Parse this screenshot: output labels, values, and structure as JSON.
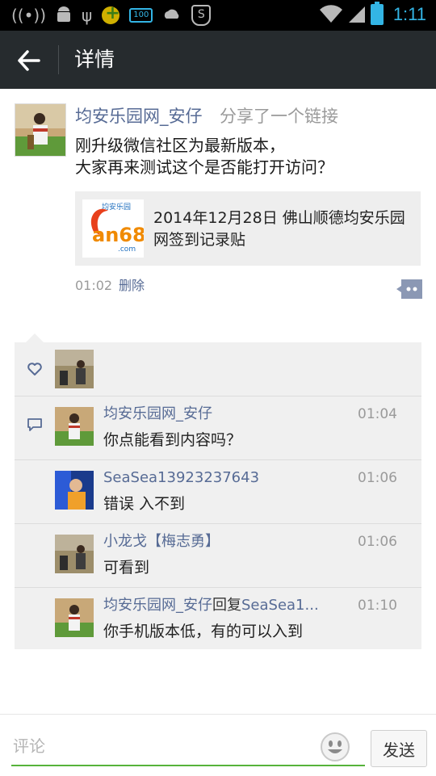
{
  "status_bar": {
    "time": "1:11",
    "battery_label": "100",
    "icons": [
      "wifi-ad-hoc-icon",
      "android-icon",
      "usb-icon",
      "plus-icon",
      "battery-pill-icon",
      "cloud-icon",
      "shield-icon",
      "wifi-icon",
      "signal-icon",
      "battery-icon"
    ]
  },
  "header": {
    "title": "详情"
  },
  "post": {
    "author": "均安乐园网_安仔",
    "action": "分享了一个链接",
    "text_line1": "刚升级微信社区为最新版本，",
    "text_line2": "大家再来测试这个是否能打开访问？",
    "link_title": "2014年12月28日 佛山顺德均安乐园网签到记录贴",
    "link_thumb_text": "an68",
    "link_thumb_sub": ".com",
    "link_thumb_top": "均安乐园",
    "time": "01:02",
    "delete_label": "删除"
  },
  "comments": [
    {
      "name": "均安乐园网_安仔",
      "reply": "",
      "reply_to": "",
      "time": "01:04",
      "text": "你点能看到内容吗？"
    },
    {
      "name": "SeaSea13923237643",
      "reply": "",
      "reply_to": "",
      "time": "01:06",
      "text": "错误  入不到"
    },
    {
      "name": "小龙戈【梅志勇】",
      "reply": "",
      "reply_to": "",
      "time": "01:06",
      "text": "可看到"
    },
    {
      "name": "均安乐园网_安仔",
      "reply": "回复",
      "reply_to": "SeaSea1...",
      "time": "01:10",
      "text": "你手机版本低，有的可以入到"
    }
  ],
  "input": {
    "placeholder": "评论",
    "send_label": "发送"
  },
  "colors": {
    "link_blue": "#576b95",
    "status_blue": "#33b5e5",
    "action_bar": "#262b2e",
    "input_green": "#56b33b"
  }
}
